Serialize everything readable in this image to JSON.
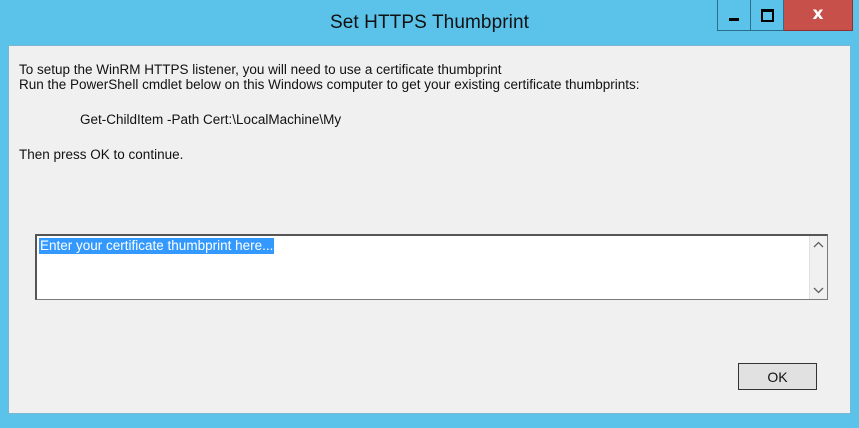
{
  "window": {
    "title": "Set HTTPS Thumbprint",
    "controls": [
      "minimize-icon",
      "maximize-icon",
      "close-icon"
    ],
    "close_glyph": "x"
  },
  "dialog": {
    "line1": "To setup the WinRM HTTPS listener, you will need to use a certificate thumbprint",
    "line2": "Run the PowerShell cmdlet below on this Windows computer to get your existing certificate thumbprints:",
    "command": "Get-ChildItem -Path Cert:\\LocalMachine\\My",
    "instruction": "Then press OK to continue."
  },
  "thumbprint_input": {
    "value": "Enter your certificate thumbprint here..."
  },
  "buttons": {
    "ok_label": "OK"
  },
  "colors": {
    "titlebar": "#5bc3ea",
    "close_button": "#c7504a",
    "client_bg": "#f0f0f0",
    "selection": "#3399ff"
  }
}
